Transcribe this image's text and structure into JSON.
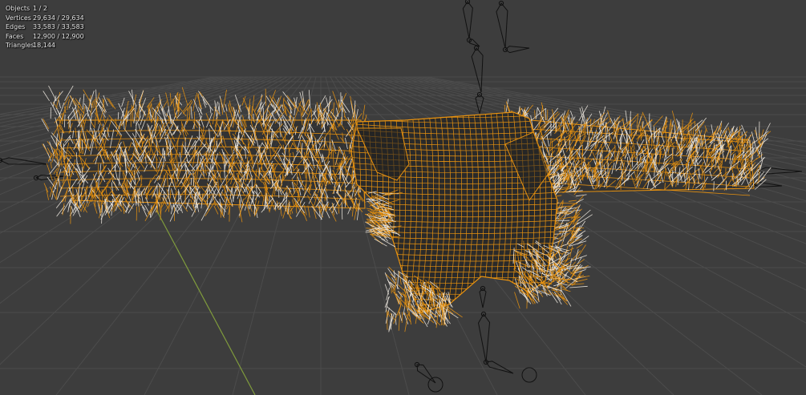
{
  "viewport": {
    "background": "#3d3d3d",
    "grid_color": "#4c4c4c",
    "y_axis_color": "#7f9b3c",
    "wire_color": "#e8920f",
    "fur_tip_color": "#f2ece3",
    "mesh_fill_color": "#2a2a2a",
    "bone_color": "#111111"
  },
  "stats": [
    {
      "label": "Objects",
      "value": "1 / 2"
    },
    {
      "label": "Vertices",
      "value": "29,634 / 29,634"
    },
    {
      "label": "Edges",
      "value": "33,583 / 33,583"
    },
    {
      "label": "Faces",
      "value": "12,900 / 12,900"
    },
    {
      "label": "Triangles",
      "value": "18,144"
    }
  ]
}
